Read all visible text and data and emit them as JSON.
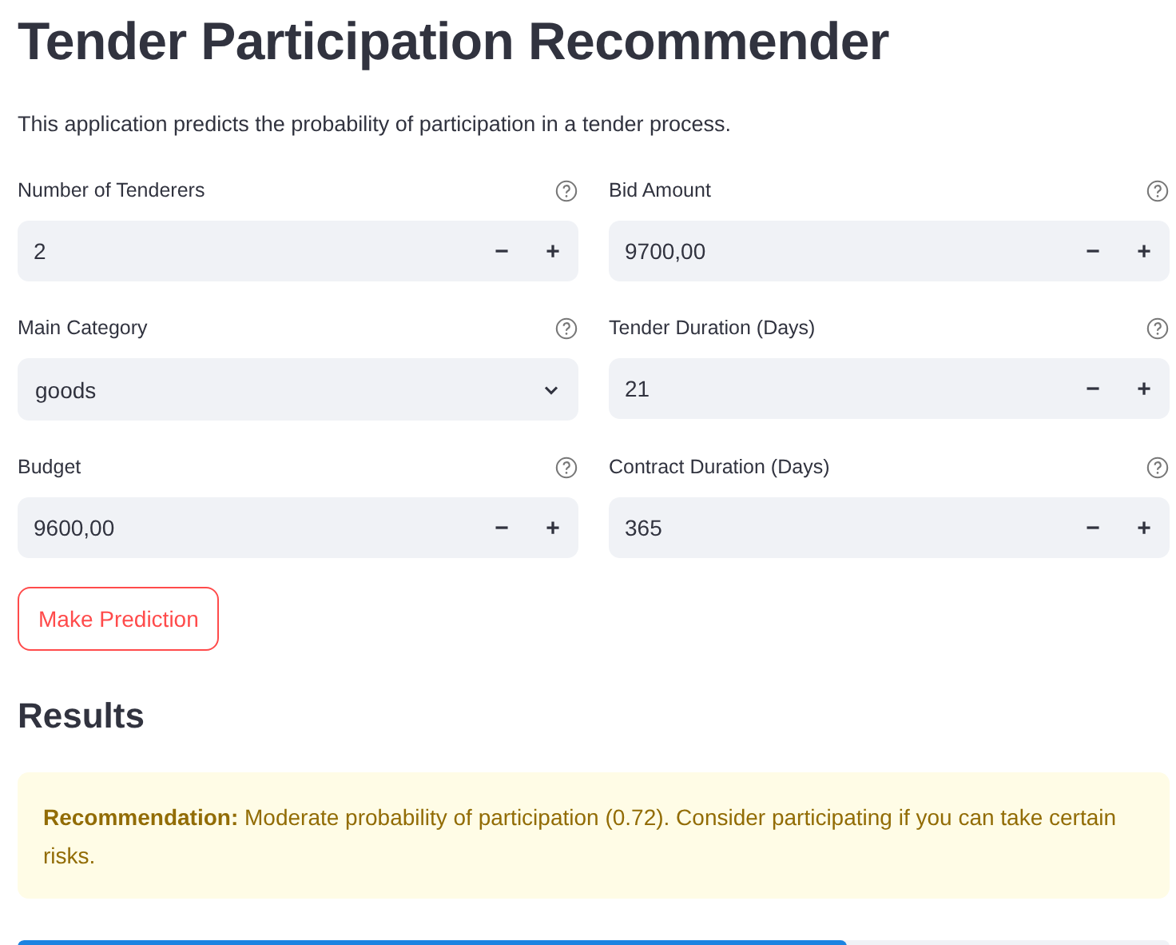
{
  "title": "Tender Participation Recommender",
  "description": "This application predicts the probability of participation in a tender process.",
  "fields": [
    {
      "label": "Number of Tenderers",
      "kind": "number",
      "value": "2",
      "minus": "−",
      "plus": "+"
    },
    {
      "label": "Bid Amount",
      "kind": "number",
      "value": "9700,00",
      "minus": "−",
      "plus": "+"
    },
    {
      "label": "Main Category",
      "kind": "select",
      "value": "goods"
    },
    {
      "label": "Tender Duration (Days)",
      "kind": "number",
      "value": "21",
      "minus": "−",
      "plus": "+"
    },
    {
      "label": "Budget",
      "kind": "number",
      "value": "9600,00",
      "minus": "−",
      "plus": "+"
    },
    {
      "label": "Contract Duration (Days)",
      "kind": "number",
      "value": "365",
      "minus": "−",
      "plus": "+"
    }
  ],
  "button": "Make Prediction",
  "results_heading": "Results",
  "recommendation": "**Recommendation:** Moderate probability of participation (0.72). Consider participating if you can take certain risks.",
  "progress": {
    "level": 0.72
  }
}
